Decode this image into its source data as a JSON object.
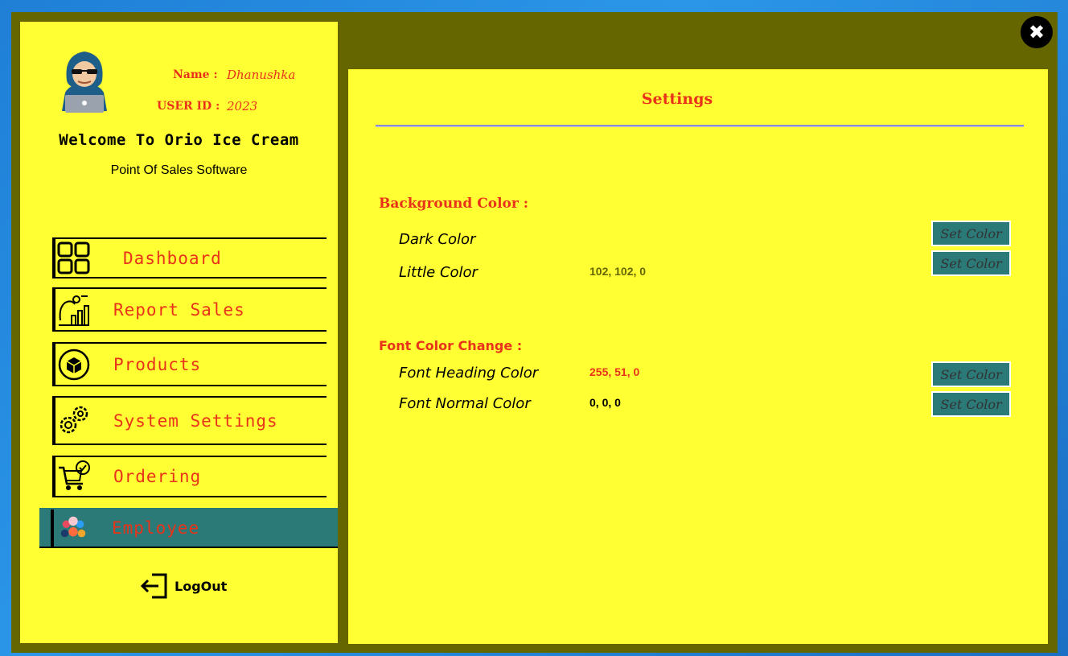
{
  "colors": {
    "frame_dark": "#666600",
    "panel_light": "#ffff33",
    "heading_font": "#e8331a",
    "normal_font": "#000000",
    "active_nav": "#2b7a78"
  },
  "user": {
    "name_label": "Name :",
    "name_value": "Dhanushka",
    "id_label": "USER ID :",
    "id_value": "2023"
  },
  "welcome": "Welcome To Orio Ice Cream",
  "subtitle": "Point Of Sales Software",
  "nav": [
    {
      "label": "Dashboard",
      "icon": "dashboard-grid-icon"
    },
    {
      "label": "Report Sales",
      "icon": "report-chart-icon"
    },
    {
      "label": "Products",
      "icon": "product-box-icon"
    },
    {
      "label": "System Settings",
      "icon": "gears-icon"
    },
    {
      "label": "Ordering",
      "icon": "cart-check-icon"
    },
    {
      "label": "Employee",
      "icon": "people-icon",
      "active": true
    }
  ],
  "logout": "LogOut",
  "close": "✖",
  "settings": {
    "title": "Settings",
    "bg_section": "Background Color :",
    "dark_label": "Dark Color",
    "little_label": "Little Color",
    "little_value": "102, 102, 0",
    "font_section": "Font Color Change :",
    "heading_label": "Font Heading Color",
    "heading_value": "255, 51, 0",
    "normal_label": "Font Normal Color",
    "normal_value": "0, 0, 0",
    "set_color": "Set Color"
  }
}
